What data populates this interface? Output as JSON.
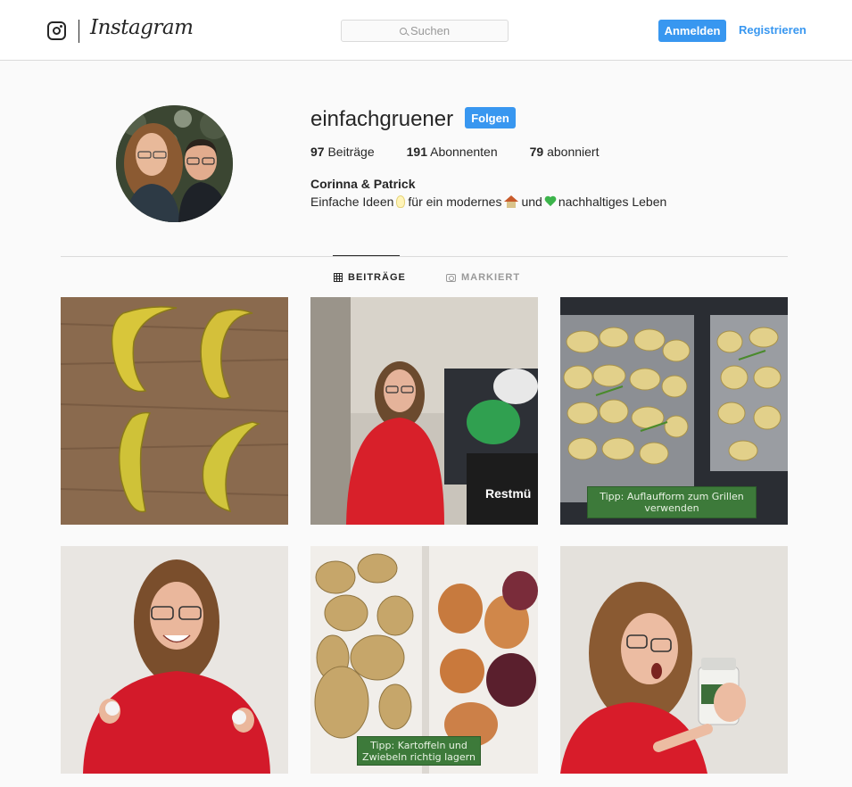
{
  "header": {
    "brand": "Instagram",
    "search_placeholder": "Suchen",
    "login_label": "Anmelden",
    "register_label": "Registrieren"
  },
  "profile": {
    "username": "einfachgruener",
    "follow_label": "Folgen",
    "stats": {
      "posts_count": "97",
      "posts_label": "Beiträge",
      "followers_count": "191",
      "followers_label": "Abonnenten",
      "following_count": "79",
      "following_label": "abonniert"
    },
    "full_name": "Corinna & Patrick",
    "bio": {
      "part1": "Einfache Ideen",
      "part2": "für ein modernes",
      "part3": "und",
      "part4": "nachhaltiges Leben"
    }
  },
  "tabs": {
    "posts": "BEITRÄGE",
    "tagged": "MARKIERT"
  },
  "posts": {
    "p3_caption_1": "Tipp: Auflaufform zum Grillen",
    "p3_caption_2": "verwenden",
    "p5_caption_1": "Tipp: Kartoffeln und",
    "p5_caption_2": "Zwiebeln richtig lagern"
  },
  "colors": {
    "accent": "#3897f0",
    "text": "#262626",
    "muted": "#999999",
    "border": "#dbdbdb",
    "background": "#fafafa"
  },
  "icons": [
    "instagram-glyph-icon",
    "search-icon",
    "grid-icon",
    "tagged-icon",
    "lightbulb-icon",
    "house-icon",
    "green-heart-icon"
  ]
}
